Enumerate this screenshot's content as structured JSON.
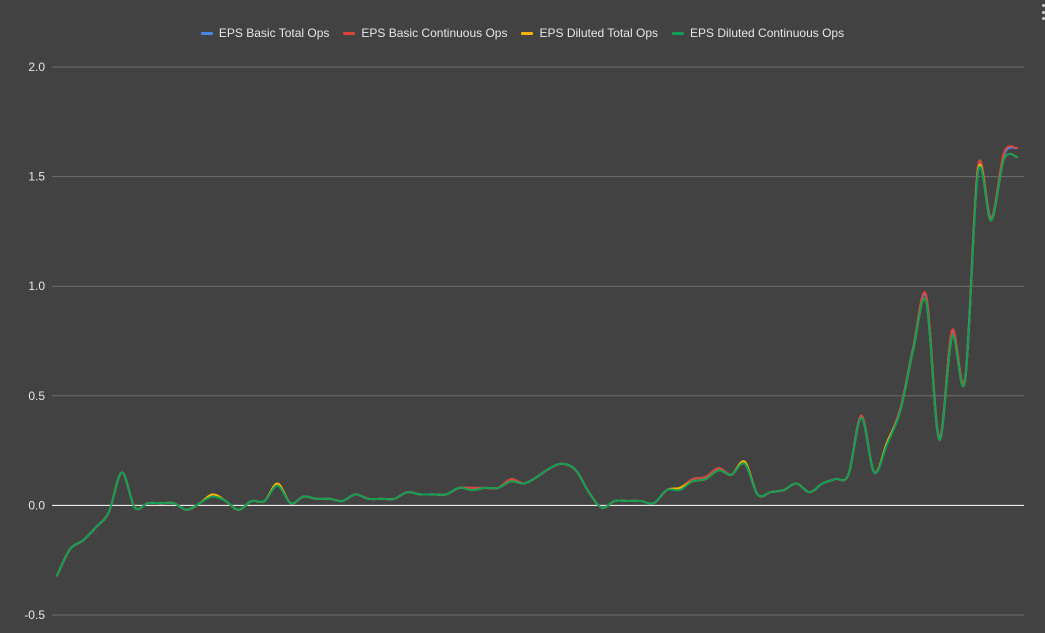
{
  "chart_data": {
    "type": "line",
    "title": "",
    "xlabel": "",
    "ylabel": "",
    "ylim": [
      -0.5,
      2.0
    ],
    "yticks": [
      "2.0",
      "1.5",
      "1.0",
      "0.5",
      "0.0",
      "-0.5"
    ],
    "grid": true,
    "legend_position": "top",
    "background": "#424242",
    "series": [
      {
        "name": "EPS Basic Total Ops",
        "color": "#4a86e8",
        "values": [
          -0.32,
          -0.2,
          -0.16,
          -0.1,
          -0.03,
          0.15,
          -0.01,
          0.01,
          0.01,
          0.01,
          -0.02,
          0.01,
          0.05,
          0.02,
          -0.02,
          0.02,
          0.02,
          0.1,
          0.01,
          0.04,
          0.03,
          0.03,
          0.02,
          0.05,
          0.03,
          0.03,
          0.03,
          0.06,
          0.05,
          0.05,
          0.05,
          0.08,
          0.08,
          0.08,
          0.08,
          0.12,
          0.1,
          0.13,
          0.17,
          0.19,
          0.16,
          0.06,
          -0.01,
          0.02,
          0.02,
          0.02,
          0.01,
          0.07,
          0.08,
          0.12,
          0.13,
          0.17,
          0.14,
          0.2,
          0.05,
          0.06,
          0.07,
          0.1,
          0.06,
          0.1,
          0.12,
          0.14,
          0.41,
          0.15,
          0.29,
          0.44,
          0.72,
          0.95,
          0.31,
          0.79,
          0.58,
          1.55,
          1.31,
          1.6,
          1.63
        ]
      },
      {
        "name": "EPS Basic Continuous Ops",
        "color": "#db4437",
        "values": [
          -0.32,
          -0.2,
          -0.16,
          -0.1,
          -0.03,
          0.15,
          -0.01,
          0.01,
          0.01,
          0.01,
          -0.02,
          0.01,
          0.05,
          0.02,
          -0.02,
          0.02,
          0.02,
          0.1,
          0.01,
          0.04,
          0.03,
          0.03,
          0.02,
          0.05,
          0.03,
          0.03,
          0.03,
          0.06,
          0.05,
          0.05,
          0.05,
          0.08,
          0.08,
          0.08,
          0.08,
          0.12,
          0.1,
          0.13,
          0.17,
          0.19,
          0.16,
          0.06,
          -0.01,
          0.02,
          0.02,
          0.02,
          0.01,
          0.07,
          0.08,
          0.12,
          0.13,
          0.17,
          0.14,
          0.19,
          0.05,
          0.06,
          0.07,
          0.1,
          0.06,
          0.1,
          0.12,
          0.14,
          0.41,
          0.15,
          0.29,
          0.44,
          0.72,
          0.96,
          0.31,
          0.8,
          0.58,
          1.55,
          1.31,
          1.61,
          1.63
        ]
      },
      {
        "name": "EPS Diluted Total Ops",
        "color": "#f4b400",
        "values": [
          -0.32,
          -0.2,
          -0.16,
          -0.1,
          -0.03,
          0.15,
          -0.01,
          0.01,
          0.01,
          0.01,
          -0.02,
          0.01,
          0.05,
          0.02,
          -0.02,
          0.02,
          0.02,
          0.1,
          0.01,
          0.04,
          0.03,
          0.03,
          0.02,
          0.05,
          0.03,
          0.03,
          0.03,
          0.06,
          0.05,
          0.05,
          0.05,
          0.08,
          0.07,
          0.08,
          0.08,
          0.11,
          0.1,
          0.13,
          0.17,
          0.19,
          0.16,
          0.06,
          -0.01,
          0.02,
          0.02,
          0.02,
          0.01,
          0.07,
          0.08,
          0.11,
          0.12,
          0.16,
          0.14,
          0.2,
          0.05,
          0.06,
          0.07,
          0.1,
          0.06,
          0.1,
          0.12,
          0.14,
          0.4,
          0.15,
          0.29,
          0.43,
          0.71,
          0.93,
          0.3,
          0.77,
          0.57,
          1.53,
          1.3,
          1.58,
          1.59
        ]
      },
      {
        "name": "EPS Diluted Continuous Ops",
        "color": "#0f9d58",
        "values": [
          -0.32,
          -0.2,
          -0.16,
          -0.1,
          -0.03,
          0.15,
          -0.01,
          0.01,
          0.01,
          0.01,
          -0.02,
          0.01,
          0.04,
          0.02,
          -0.02,
          0.02,
          0.02,
          0.09,
          0.01,
          0.04,
          0.03,
          0.03,
          0.02,
          0.05,
          0.03,
          0.03,
          0.03,
          0.06,
          0.05,
          0.05,
          0.05,
          0.08,
          0.07,
          0.08,
          0.08,
          0.11,
          0.1,
          0.13,
          0.17,
          0.19,
          0.16,
          0.06,
          -0.01,
          0.02,
          0.02,
          0.02,
          0.01,
          0.07,
          0.07,
          0.11,
          0.12,
          0.16,
          0.14,
          0.19,
          0.05,
          0.06,
          0.07,
          0.1,
          0.06,
          0.1,
          0.12,
          0.14,
          0.4,
          0.15,
          0.28,
          0.43,
          0.71,
          0.93,
          0.3,
          0.77,
          0.57,
          1.52,
          1.3,
          1.58,
          1.59
        ]
      }
    ]
  }
}
